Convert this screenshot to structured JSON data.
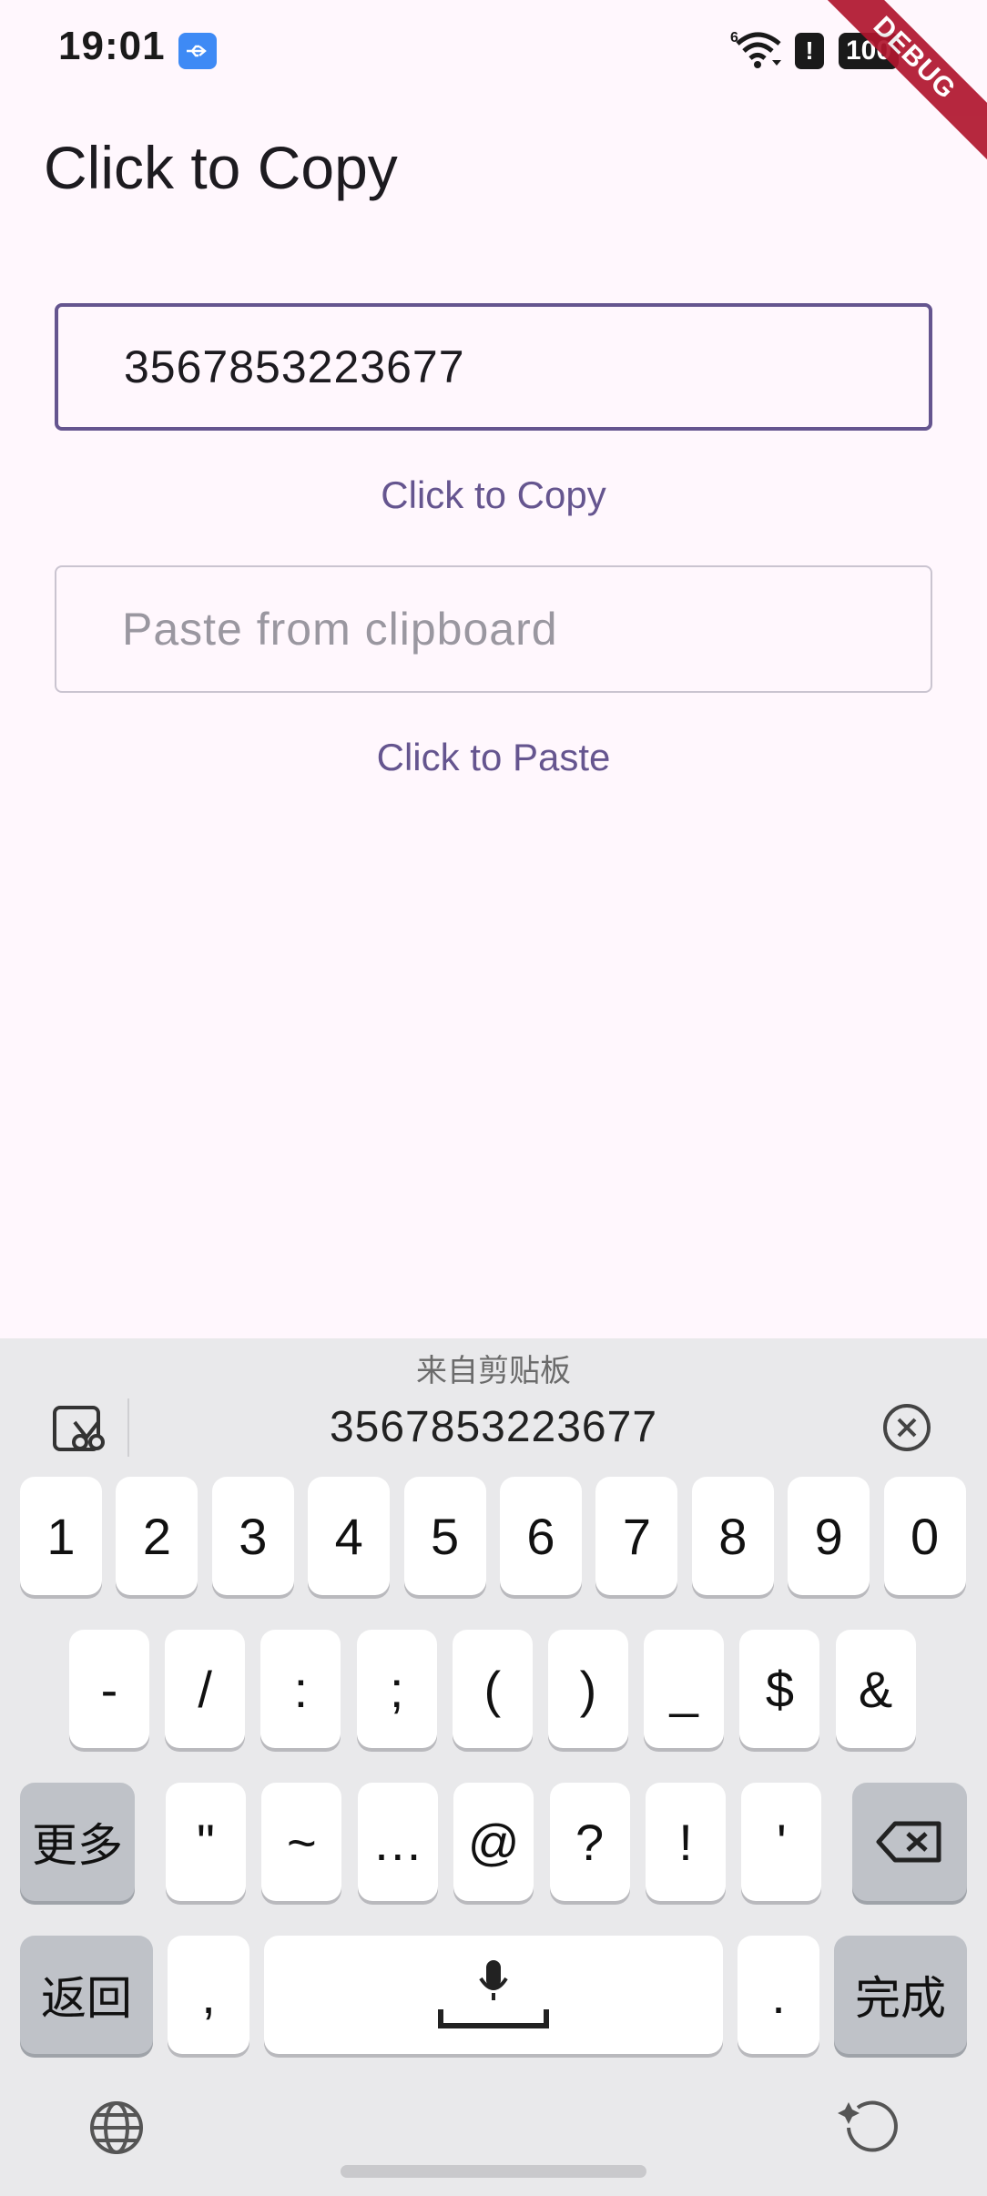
{
  "status": {
    "time": "19:01",
    "wifi_label": "6",
    "alert": "!",
    "battery": "100",
    "debug": "DEBUG"
  },
  "app": {
    "title": "Click to Copy",
    "copy_field_value": "3567853223677",
    "copy_button": "Click to Copy",
    "paste_placeholder": "Paste from clipboard",
    "paste_button": "Click to Paste"
  },
  "keyboard": {
    "clipboard_caption": "来自剪贴板",
    "clipboard_item": "3567853223677",
    "row1": [
      "1",
      "2",
      "3",
      "4",
      "5",
      "6",
      "7",
      "8",
      "9",
      "0"
    ],
    "row2": [
      "-",
      "/",
      ":",
      ";",
      "(",
      ")",
      "_",
      "$",
      "&"
    ],
    "more": "更多",
    "row3": [
      "\"",
      "~",
      "…",
      "@",
      "?",
      "!",
      "'"
    ],
    "back": "返回",
    "comma": ",",
    "period": ".",
    "done": "完成"
  },
  "colors": {
    "accent": "#65558F",
    "background": "#FFF7FD",
    "keyboard": "#E9E9EB"
  }
}
